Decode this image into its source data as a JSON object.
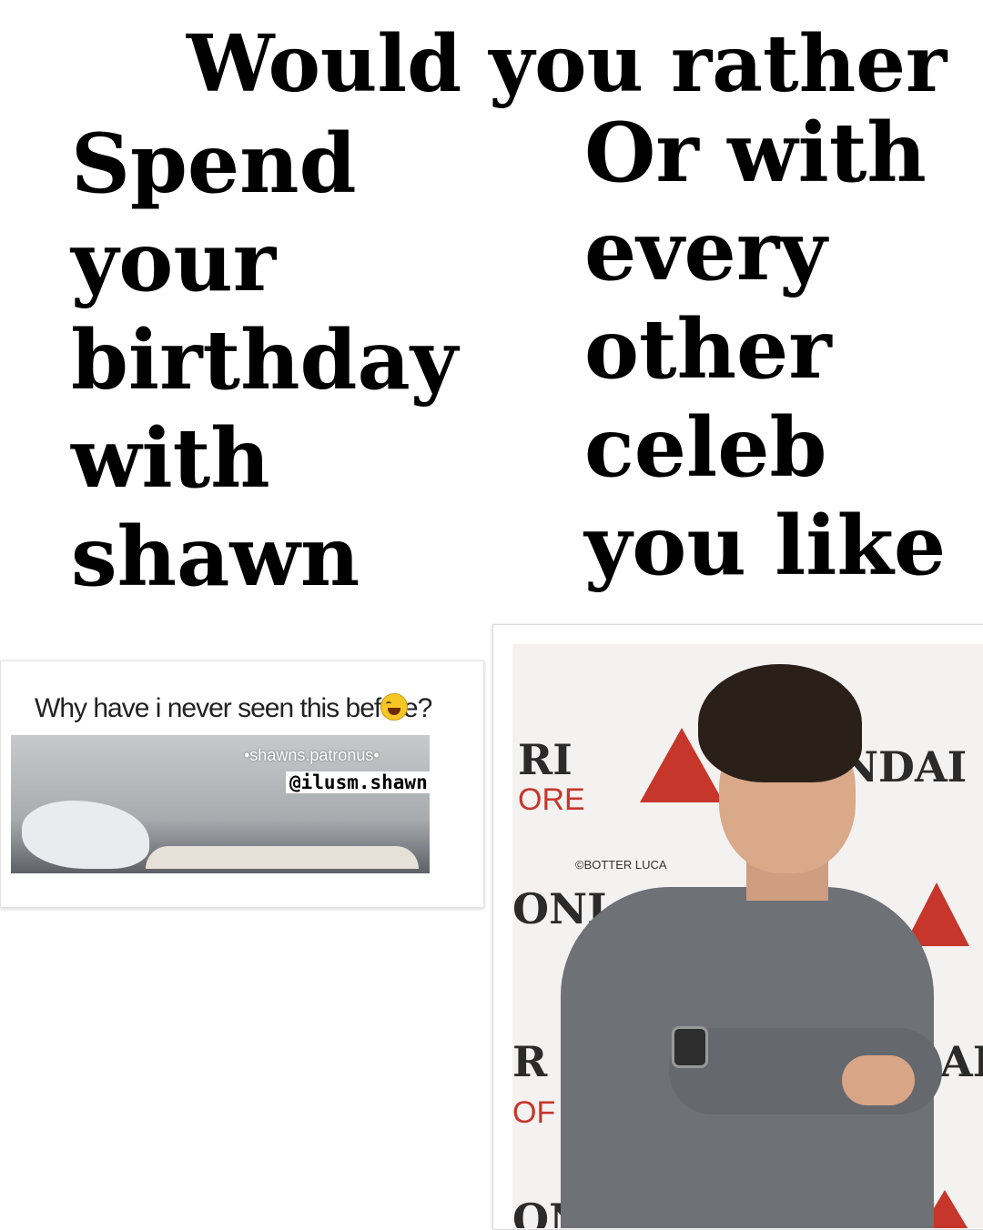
{
  "headline": "Would you rather",
  "left_option": [
    "Spend",
    "your",
    "birthday",
    "with",
    "shawn"
  ],
  "right_option": [
    "Or with",
    "every",
    "other",
    "celeb",
    "you like"
  ],
  "left_card": {
    "caption": "Why have i never seen this before?",
    "watermark_1": "•shawns.patronus•",
    "watermark_2": "@ilusm.shawn"
  },
  "right_photo": {
    "backdrop_text": [
      "RI",
      "ORE",
      "NDAI",
      "ONI",
      "R",
      "OF",
      "ON",
      "A",
      "AL"
    ],
    "credit": "©BOTTER LUCA"
  }
}
